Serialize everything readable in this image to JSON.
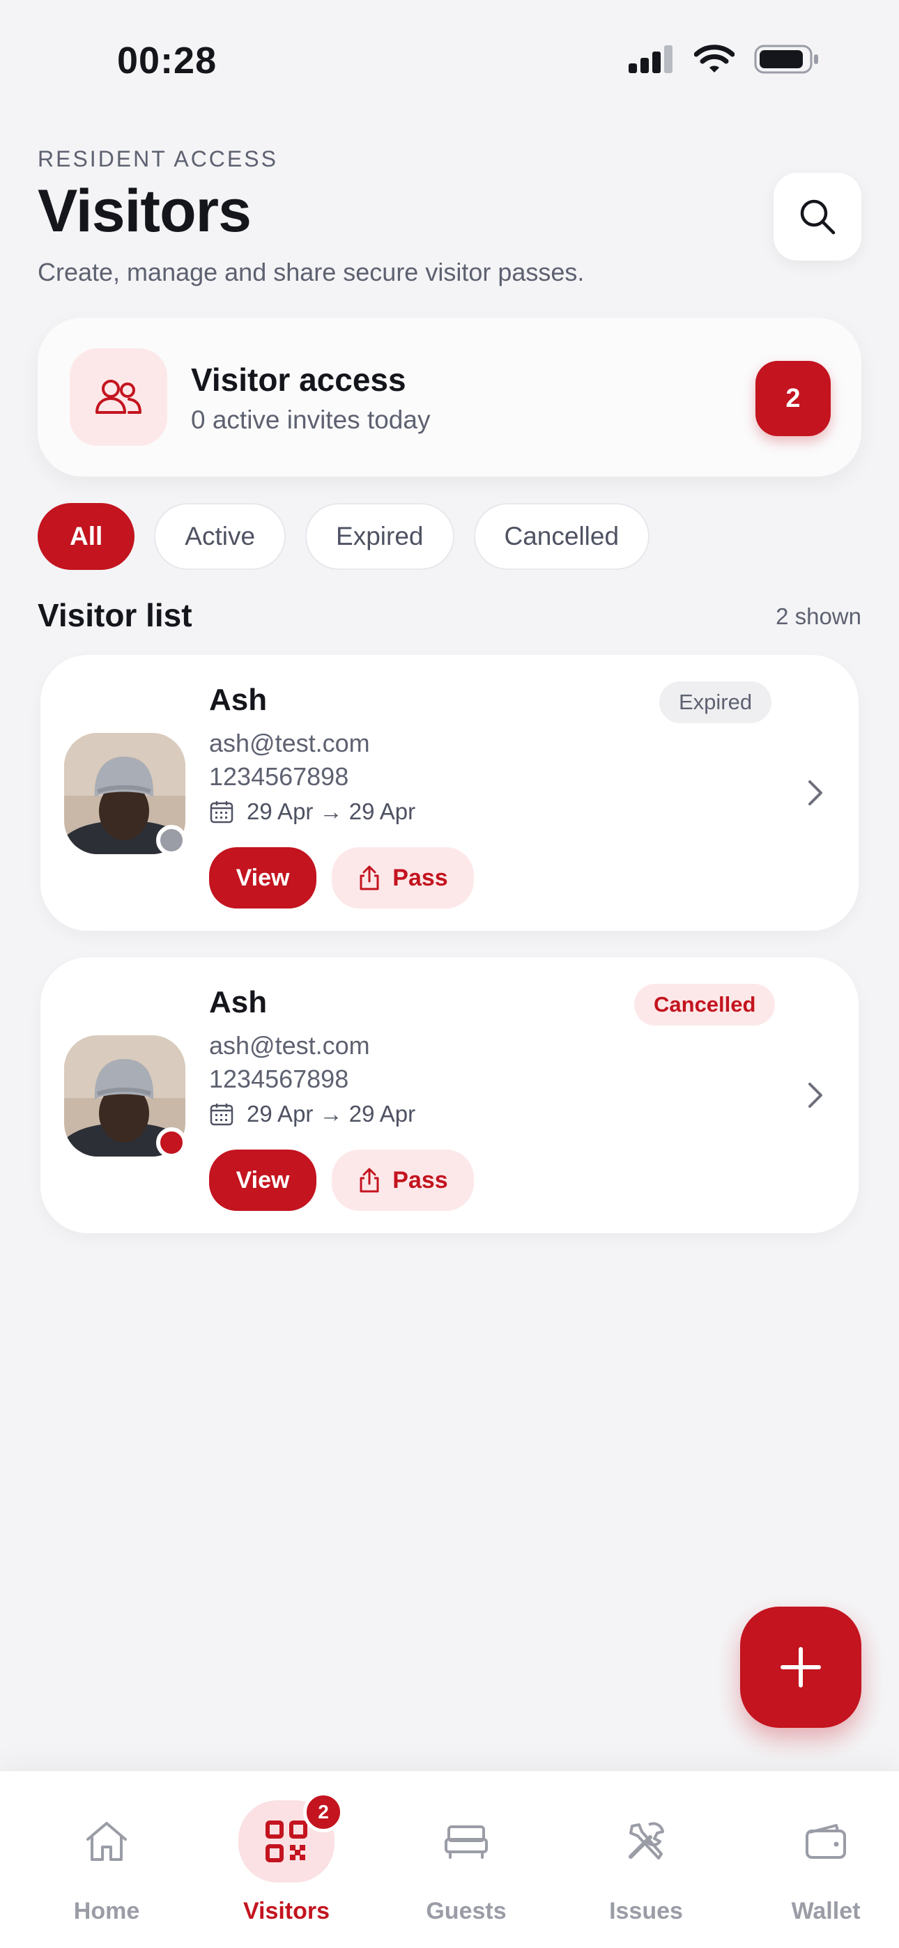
{
  "status_bar": {
    "time": "00:28"
  },
  "header": {
    "eyebrow": "RESIDENT ACCESS",
    "title": "Visitors",
    "subtitle": "Create, manage and share secure visitor passes."
  },
  "summary": {
    "title": "Visitor access",
    "subtitle": "0 active invites today",
    "count": "2"
  },
  "filters": [
    {
      "label": "All",
      "active": true
    },
    {
      "label": "Active",
      "active": false
    },
    {
      "label": "Expired",
      "active": false
    },
    {
      "label": "Cancelled",
      "active": false
    }
  ],
  "list": {
    "title": "Visitor list",
    "count_text": "2 shown",
    "visitors": [
      {
        "name": "Ash",
        "email": "ash@test.com",
        "phone": "1234567898",
        "dates": "29 Apr → 29 Apr",
        "status": "Expired",
        "view_label": "View",
        "pass_label": "Pass"
      },
      {
        "name": "Ash",
        "email": "ash@test.com",
        "phone": "1234567898",
        "dates": "29 Apr → 29 Apr",
        "status": "Cancelled",
        "view_label": "View",
        "pass_label": "Pass"
      }
    ]
  },
  "bottom_nav": {
    "items": [
      {
        "label": "Home",
        "icon": "home-icon"
      },
      {
        "label": "Visitors",
        "icon": "qr-code-icon",
        "badge": "2",
        "active": true
      },
      {
        "label": "Guests",
        "icon": "bed-icon"
      },
      {
        "label": "Issues",
        "icon": "tools-icon"
      },
      {
        "label": "Wallet",
        "icon": "wallet-icon"
      }
    ]
  },
  "colors": {
    "accent": "#c3141f",
    "accent_soft": "#fde8e9",
    "background": "#f4f4f6",
    "muted_text": "#5d6170",
    "expired_dot": "#9a9ca6"
  }
}
